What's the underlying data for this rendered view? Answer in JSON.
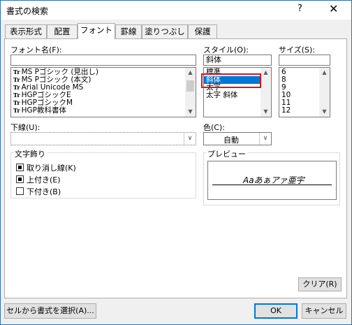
{
  "dialog": {
    "title": "書式の検索",
    "help": "?",
    "close": "✕"
  },
  "tabs": [
    {
      "label": "表示形式"
    },
    {
      "label": "配置"
    },
    {
      "label": "フォント"
    },
    {
      "label": "罫線"
    },
    {
      "label": "塗りつぶし"
    },
    {
      "label": "保護"
    }
  ],
  "font": {
    "label": "フォント名(F):",
    "items": [
      "MS Pゴシック (見出し)",
      "MS Pゴシック (本文)",
      "Arial Unicode MS",
      "HGPゴシックE",
      "HGPゴシックM",
      "HGP教科書体"
    ],
    "tt_glyph": "Tr"
  },
  "style": {
    "label": "スタイル(O):",
    "value": "斜体",
    "items": [
      "標準",
      "斜体",
      "太字",
      "太字 斜体"
    ]
  },
  "size": {
    "label": "サイズ(S):",
    "items": [
      "6",
      "8",
      "9",
      "10",
      "11",
      "12"
    ]
  },
  "underline": {
    "label": "下線(U):",
    "value": ""
  },
  "color": {
    "label": "色(C):",
    "value": "自動"
  },
  "effects": {
    "label": "文字飾り",
    "items": [
      {
        "label": "取り消し線(K)",
        "checked": true
      },
      {
        "label": "上付き(E)",
        "checked": true
      },
      {
        "label": "下付き(B)",
        "checked": false
      }
    ]
  },
  "preview": {
    "label": "プレビュー",
    "sample": "Aaあぁアァ亜宇"
  },
  "buttons": {
    "clear": "クリア(R)",
    "select_from_cell": "セルから書式を選択(A)...",
    "ok": "OK",
    "cancel": "キャンセル"
  }
}
